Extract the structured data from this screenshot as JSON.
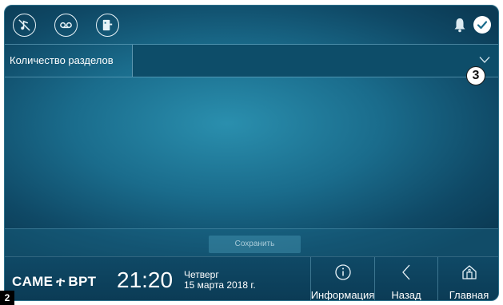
{
  "topbar": {
    "icons": [
      "do-not-disturb-icon",
      "answering-machine-icon",
      "door-open-icon"
    ],
    "bell_icon": "bell-icon",
    "status_icon": "check-icon"
  },
  "form": {
    "sections_label": "Количество разделов",
    "sections_value": "",
    "callout": "3"
  },
  "save_button": "Сохранить",
  "footer": {
    "brand_left": "CAME",
    "brand_right": "BPT",
    "time": "21:20",
    "weekday": "Четверг",
    "date": "15 марта 2018 г.",
    "nav": {
      "info": "Информация",
      "back": "Назад",
      "home": "Главная"
    }
  },
  "page_number": "2",
  "colors": {
    "accent": "#1a6c8c",
    "panel": "#0d4d69"
  }
}
